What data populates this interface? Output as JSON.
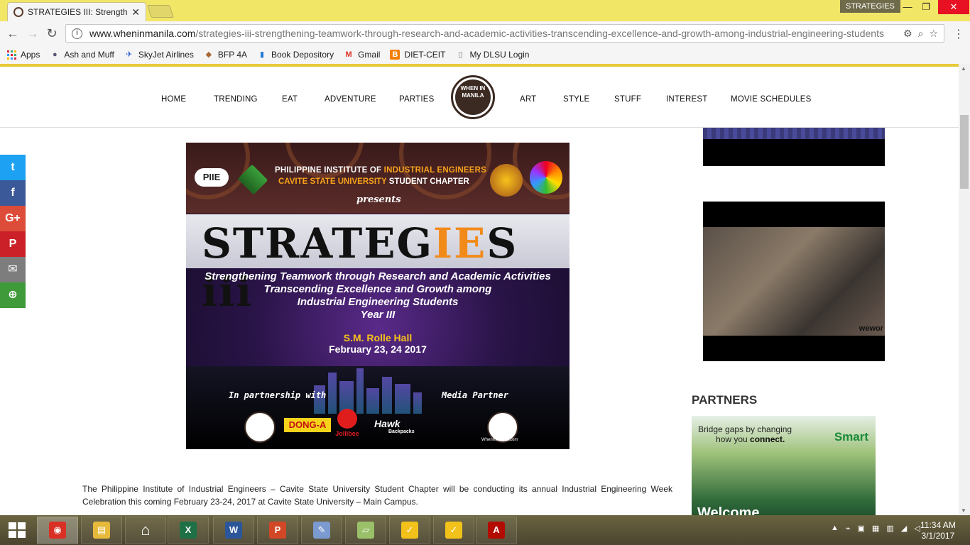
{
  "browser": {
    "tab_title": "STRATEGIES III: Strengthe",
    "tab_close": "✕",
    "profile_name": "STRATEGIES",
    "window_controls": {
      "minimize": "—",
      "restore": "❐",
      "close": "✕"
    },
    "nav": {
      "back": "←",
      "forward": "→",
      "reload": "↻"
    },
    "url_host": "www.wheninmanila.com",
    "url_path": "/strategies-iii-strengthening-teamwork-through-research-and-academic-activities-transcending-excellence-and-growth-among-industrial-engineering-students",
    "menu": "⋮",
    "omnibox_icons": {
      "extension": "⚙",
      "zoom": "⌕",
      "star": "☆"
    }
  },
  "bookmarks": [
    {
      "label": "Apps",
      "icon": "apps-grid-icon"
    },
    {
      "label": "Ash and Muff",
      "icon": "person-icon"
    },
    {
      "label": "SkyJet Airlines",
      "icon": "plane-icon"
    },
    {
      "label": "BFP 4A",
      "icon": "shield-icon"
    },
    {
      "label": "Book Depository",
      "icon": "book-icon"
    },
    {
      "label": "Gmail",
      "icon": "gmail-icon"
    },
    {
      "label": "DIET-CEIT",
      "icon": "blogger-icon"
    },
    {
      "label": "My DLSU Login",
      "icon": "page-icon"
    }
  ],
  "site_nav": {
    "left": [
      "HOME",
      "TRENDING",
      "EAT",
      "ADVENTURE",
      "PARTIES"
    ],
    "right": [
      "ART",
      "STYLE",
      "STUFF",
      "INTEREST",
      "MOVIE SCHEDULES"
    ],
    "logo_text": "WHEN IN MANILA"
  },
  "share": [
    {
      "name": "twitter",
      "glyph": "t",
      "color": "#1da1f2"
    },
    {
      "name": "facebook",
      "glyph": "f",
      "color": "#3b5998"
    },
    {
      "name": "google-plus",
      "glyph": "G+",
      "color": "#dd4b39"
    },
    {
      "name": "pinterest",
      "glyph": "P",
      "color": "#cb2027"
    },
    {
      "name": "email",
      "glyph": "✉",
      "color": "#7d7d7d"
    },
    {
      "name": "more",
      "glyph": "⊕",
      "color": "#3f9a3a"
    }
  ],
  "poster": {
    "badge_left": "PIIE",
    "org_line1_a": "PHILIPPINE INSTITUTE OF ",
    "org_line1_b": "INDUSTRIAL ENGINEERS",
    "org_line2_a": "CAVITE STATE UNIVERSITY ",
    "org_line2_b": "STUDENT CHAPTER",
    "presents": "presents",
    "title_a": "STRATEG",
    "title_b": "IE",
    "title_c": "S iii",
    "sub1": "Strengthening Teamwork through Research and Academic Activities",
    "sub2": "Transcending Excellence and Growth among",
    "sub3": "Industrial Engineering Students",
    "sub4": "Year III",
    "venue": "S.M. Rolle Hall",
    "date": "February 23, 24 2017",
    "partnership_label": "In partnership with",
    "media_label": "Media Partner",
    "sponsor_dong": "DONG-A",
    "sponsor_jollibee": "Jollibee",
    "sponsor_hawk": "Hawk",
    "sponsor_hawk_sub": "Backpacks",
    "media_url": "WhenInManila.com"
  },
  "article": {
    "paragraph": "The Philippine Institute of Industrial Engineers – Cavite State University Student Chapter will be conducting its annual Industrial Engineering Week Celebration this coming February 23-24, 2017 at Cavite State University – Main Campus."
  },
  "sidebar": {
    "ad2_brand": "wewor",
    "partners_heading": "PARTNERS",
    "smart_line1": "Bridge gaps by changing",
    "smart_line2_a": "how you ",
    "smart_line2_b": "connect.",
    "smart_logo": "Smart",
    "smart_welcome": "Welcome"
  },
  "taskbar": {
    "apps": [
      {
        "name": "chrome",
        "glyph": "◉",
        "color": "#d93025",
        "active": true
      },
      {
        "name": "file-explorer",
        "glyph": "▤",
        "color": "#e6b93a"
      },
      {
        "name": "home",
        "glyph": "⌂",
        "color": "#ffffff"
      },
      {
        "name": "excel",
        "glyph": "X",
        "color": "#1e7145"
      },
      {
        "name": "word",
        "glyph": "W",
        "color": "#2b579a"
      },
      {
        "name": "powerpoint",
        "glyph": "P",
        "color": "#d24726"
      },
      {
        "name": "paint",
        "glyph": "✎",
        "color": "#7a9ad0"
      },
      {
        "name": "notes",
        "glyph": "▱",
        "color": "#9ac06a"
      },
      {
        "name": "norton",
        "glyph": "✓",
        "color": "#f2c21b"
      },
      {
        "name": "norton-2",
        "glyph": "✓",
        "color": "#f2c21b"
      },
      {
        "name": "acrobat",
        "glyph": "A",
        "color": "#b30b00"
      }
    ],
    "time": "11:34 AM",
    "date": "3/1/2017",
    "tray_icons": [
      "▲",
      "⌁",
      "▣",
      "▦",
      "▥",
      "◢",
      "◁"
    ]
  }
}
